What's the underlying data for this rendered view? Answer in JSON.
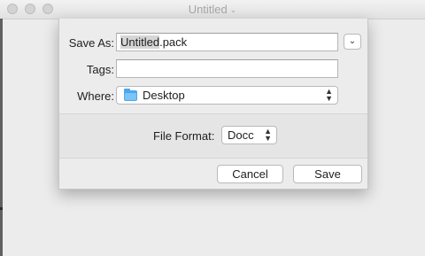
{
  "window": {
    "title": "Untitled"
  },
  "save_sheet": {
    "save_as_label": "Save As:",
    "filename_selected": "Untitled",
    "filename_extension": ".pack",
    "tags_label": "Tags:",
    "tags_value": "",
    "where_label": "Where:",
    "where_value": "Desktop",
    "file_format_label": "File Format:",
    "file_format_value": "Docc",
    "cancel_label": "Cancel",
    "save_label": "Save"
  },
  "colors": {
    "folder_blue": "#4aa8ef"
  }
}
